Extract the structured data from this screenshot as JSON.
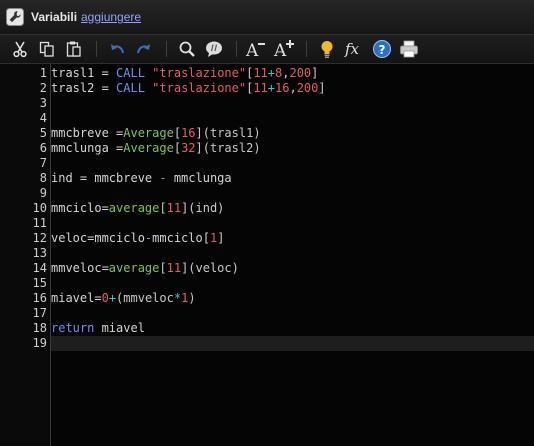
{
  "header": {
    "title": "Variabili",
    "link": "aggiungere"
  },
  "toolbar": {
    "buttons": [
      {
        "name": "cut-icon"
      },
      {
        "name": "copy-icon"
      },
      {
        "name": "paste-icon"
      },
      {
        "name": "undo-icon"
      },
      {
        "name": "redo-icon"
      },
      {
        "name": "search-icon"
      },
      {
        "name": "comment-icon"
      },
      {
        "name": "decrease-font-icon",
        "glyph": "A"
      },
      {
        "name": "increase-font-icon",
        "glyph": "A"
      },
      {
        "name": "lightbulb-icon"
      },
      {
        "name": "function-icon",
        "glyph": "fx"
      },
      {
        "name": "help-icon",
        "glyph": "?"
      },
      {
        "name": "print-icon"
      }
    ]
  },
  "editor": {
    "current_line": 19,
    "line_numbers": [
      "1",
      "2",
      "3",
      "4",
      "5",
      "6",
      "7",
      "8",
      "9",
      "10",
      "11",
      "12",
      "13",
      "14",
      "15",
      "16",
      "17",
      "18",
      "19"
    ],
    "lines": [
      [
        {
          "t": "trasl1 = ",
          "c": "nm"
        },
        {
          "t": "CALL",
          "c": "kw"
        },
        {
          "t": " ",
          "c": "nm"
        },
        {
          "t": "\"traslazione\"",
          "c": "st"
        },
        {
          "t": "[",
          "c": "br"
        },
        {
          "t": "11",
          "c": "st"
        },
        {
          "t": "+",
          "c": "op2"
        },
        {
          "t": "8",
          "c": "st"
        },
        {
          "t": ",",
          "c": "br"
        },
        {
          "t": "200",
          "c": "st"
        },
        {
          "t": "]",
          "c": "br"
        }
      ],
      [
        {
          "t": "trasl2 = ",
          "c": "nm"
        },
        {
          "t": "CALL",
          "c": "kw"
        },
        {
          "t": " ",
          "c": "nm"
        },
        {
          "t": "\"traslazione\"",
          "c": "st"
        },
        {
          "t": "[",
          "c": "br"
        },
        {
          "t": "11",
          "c": "st"
        },
        {
          "t": "+",
          "c": "op2"
        },
        {
          "t": "16",
          "c": "st"
        },
        {
          "t": ",",
          "c": "br"
        },
        {
          "t": "200",
          "c": "st"
        },
        {
          "t": "]",
          "c": "br"
        }
      ],
      [],
      [],
      [
        {
          "t": "mmcbreve =",
          "c": "nm"
        },
        {
          "t": "Average",
          "c": "fn"
        },
        {
          "t": "[",
          "c": "br"
        },
        {
          "t": "16",
          "c": "st"
        },
        {
          "t": "](trasl1)",
          "c": "br"
        }
      ],
      [
        {
          "t": "mmclunga =",
          "c": "nm"
        },
        {
          "t": "Average",
          "c": "fn"
        },
        {
          "t": "[",
          "c": "br"
        },
        {
          "t": "32",
          "c": "st"
        },
        {
          "t": "](trasl2)",
          "c": "br"
        }
      ],
      [],
      [
        {
          "t": "ind = mmcbreve ",
          "c": "nm"
        },
        {
          "t": "-",
          "c": "op"
        },
        {
          "t": " mmclunga",
          "c": "nm"
        }
      ],
      [],
      [
        {
          "t": "mmciclo=",
          "c": "nm"
        },
        {
          "t": "average",
          "c": "fn"
        },
        {
          "t": "[",
          "c": "br"
        },
        {
          "t": "11",
          "c": "st"
        },
        {
          "t": "](ind)",
          "c": "br"
        }
      ],
      [],
      [
        {
          "t": "veloc=mmciclo",
          "c": "nm"
        },
        {
          "t": "-",
          "c": "op"
        },
        {
          "t": "mmciclo[",
          "c": "nm"
        },
        {
          "t": "1",
          "c": "st"
        },
        {
          "t": "]",
          "c": "br"
        }
      ],
      [],
      [
        {
          "t": "mmveloc=",
          "c": "nm"
        },
        {
          "t": "average",
          "c": "fn"
        },
        {
          "t": "[",
          "c": "br"
        },
        {
          "t": "11",
          "c": "st"
        },
        {
          "t": "](veloc)",
          "c": "br"
        }
      ],
      [],
      [
        {
          "t": "miavel=",
          "c": "nm"
        },
        {
          "t": "0",
          "c": "st"
        },
        {
          "t": "+",
          "c": "op2"
        },
        {
          "t": "(mmveloc",
          "c": "br"
        },
        {
          "t": "*",
          "c": "op2"
        },
        {
          "t": "1",
          "c": "st"
        },
        {
          "t": ")",
          "c": "br"
        }
      ],
      [],
      [
        {
          "t": "return",
          "c": "kw"
        },
        {
          "t": " miavel",
          "c": "nm"
        }
      ],
      []
    ]
  }
}
